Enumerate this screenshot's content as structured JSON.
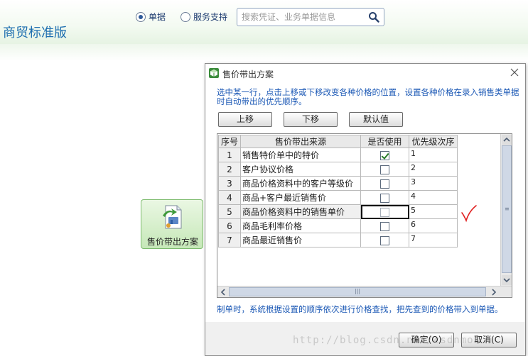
{
  "header": {
    "app_title": "商贸标准版",
    "radio_documents": "单据",
    "radio_service": "服务支持",
    "search_placeholder": "搜索凭证、业务单据信息"
  },
  "desktop": {
    "tile_label": "售价带出方案"
  },
  "dialog": {
    "title": "售价带出方案",
    "hint": "选中某一行，点击上移或下移改变各种价格的位置，设置各种价格在录入销售类单据时自动带出的优先顺序。",
    "buttons": {
      "up": "上移",
      "down": "下移",
      "default": "默认值",
      "ok": "确定(O)",
      "cancel": "取消(C)"
    },
    "table": {
      "headers": [
        "序号",
        "售价带出来源",
        "是否使用",
        "优先级次序"
      ],
      "rows": [
        {
          "no": "1",
          "source": "销售特价单中的特价",
          "used": true,
          "priority": "1"
        },
        {
          "no": "2",
          "source": "客户协议价格",
          "used": false,
          "priority": "2"
        },
        {
          "no": "3",
          "source": "商品价格资料中的客户等级价",
          "used": false,
          "priority": "3"
        },
        {
          "no": "4",
          "source": "商品+客户最近销售价",
          "used": false,
          "priority": "4"
        },
        {
          "no": "5",
          "source": "商品价格资料中的销售单价",
          "used": false,
          "priority": "5"
        },
        {
          "no": "6",
          "source": "商品毛利率价格",
          "used": false,
          "priority": "6"
        },
        {
          "no": "7",
          "source": "商品最近销售价",
          "used": false,
          "priority": "7"
        }
      ]
    },
    "footer_hint": "制单时，系统根据设置的顺序依次进行价格查找，把先查到的价格带入到单据。"
  },
  "watermark": "http://blog.csdn.net/csdnmos",
  "colors": {
    "accent_blue": "#1b58b5",
    "tile_green": "#c6e8b8",
    "annotation_red": "#e02020"
  }
}
